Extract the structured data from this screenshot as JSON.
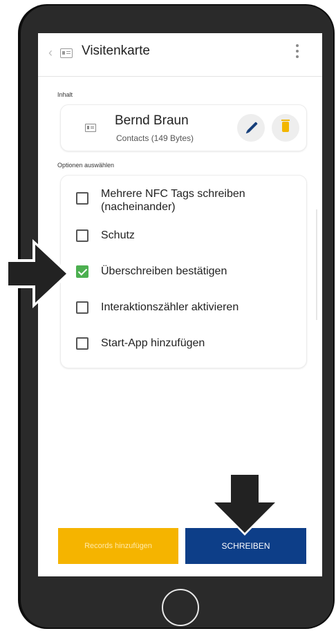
{
  "app": {
    "title": "Visitenkarte"
  },
  "content": {
    "section_label": "Inhalt",
    "contact_name": "Bernd Braun",
    "contact_detail": "Contacts (149 Bytes)"
  },
  "options": {
    "section_label": "Optionen auswählen",
    "items": [
      {
        "line1": "Mehrere NFC Tags schreiben",
        "line2": "(nacheinander)",
        "checked": false
      },
      {
        "line1": "Schutz",
        "checked": false
      },
      {
        "line1": "Überschreiben bestätigen",
        "checked": true
      },
      {
        "line1": "Interaktionszähler aktivieren",
        "checked": false
      },
      {
        "line1": "Start-App hinzufügen",
        "checked": false
      }
    ]
  },
  "buttons": {
    "records": "Records hinzufügen",
    "write": "SCHREIBEN"
  },
  "colors": {
    "accent_yellow": "#f5b400",
    "primary_blue": "#0d3e88",
    "check_green": "#4caf50",
    "pencil_blue": "#163f7a",
    "phone_frame": "#2a2a2a"
  },
  "icons": {
    "back": "chevron-left-icon",
    "vcard": "vcard-icon",
    "menu": "kebab-menu-icon",
    "edit": "pencil-icon",
    "delete": "trash-icon",
    "home": "home-button-icon",
    "annotation_right": "arrow-right-icon",
    "annotation_down": "arrow-down-icon"
  }
}
